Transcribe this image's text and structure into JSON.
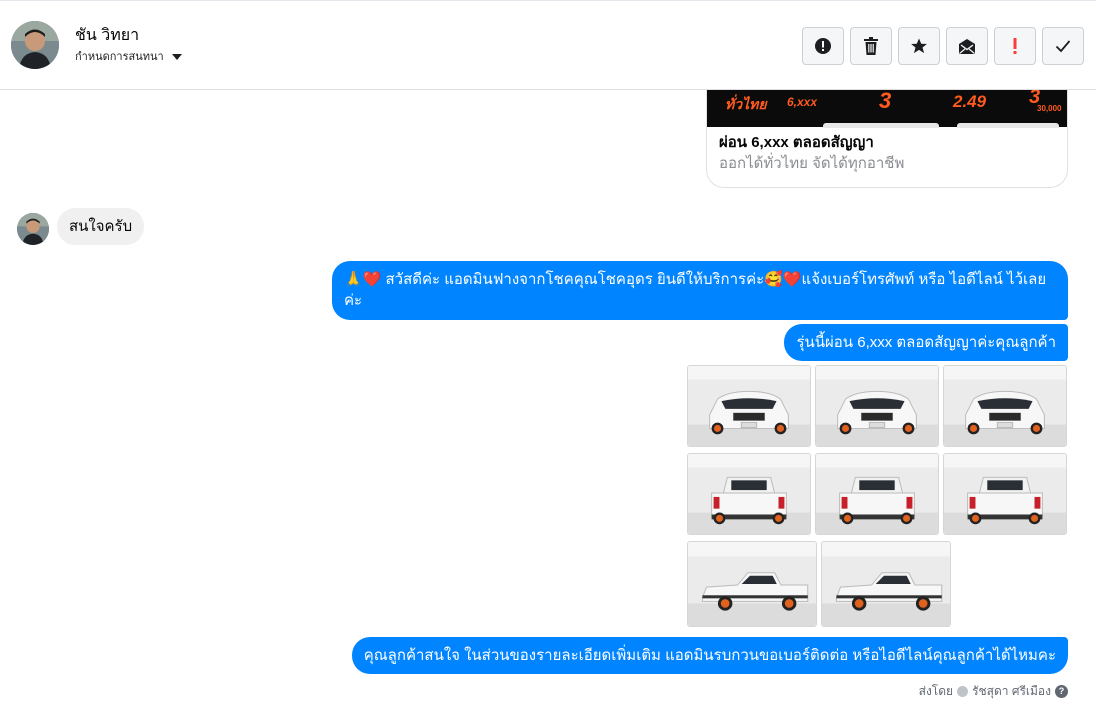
{
  "header": {
    "name": "ชัน วิทยา",
    "assign_label": "กำหนดการสนทนา",
    "actions": [
      {
        "id": "report",
        "icon": "alert-circle-icon"
      },
      {
        "id": "delete",
        "icon": "trash-icon"
      },
      {
        "id": "star",
        "icon": "star-icon"
      },
      {
        "id": "mark-unread",
        "icon": "envelope-icon"
      },
      {
        "id": "important",
        "icon": "exclamation-icon",
        "color": "#fa3e3e"
      },
      {
        "id": "done",
        "icon": "check-icon"
      }
    ]
  },
  "ad": {
    "banner": {
      "t1": "ทั่วไทย",
      "t2": "6,xxx",
      "t3": "3",
      "t4": "2.49",
      "t5": "3",
      "t6": "30,000"
    },
    "title": "ผ่อน 6,xxx ตลอดสัญญา",
    "subtitle": "ออกได้ทั่วไทย จัดได้ทุกอาชีพ"
  },
  "messages": {
    "incoming": "สนใจครับ",
    "out1": "🙏❤️ สวัสดีค่ะ แอดมินฟางจากโชคคุณโชคอุดร ยินดีให้บริการค่ะ🥰❤️แจ้งเบอร์โทรศัพท์ หรือ ไอดีไลน์  ไว้เลยค่ะ",
    "out2": "รุ่นนี้ผ่อน 6,xxx ตลอดสัญญาค่ะคุณลูกค้า",
    "out3": "คุณลูกค้าสนใจ ในส่วนของรายละเอียดเพิ่มเติม แอดมินรบกวนขอเบอร์ติดต่อ หรือไอดีไลน์คุณลูกค้าได้ไหมคะ"
  },
  "photos": [
    {
      "view": "front-left"
    },
    {
      "view": "front"
    },
    {
      "view": "front-right"
    },
    {
      "view": "rear-left"
    },
    {
      "view": "rear"
    },
    {
      "view": "rear-right"
    },
    {
      "view": "side-left"
    },
    {
      "view": "side-right"
    }
  ],
  "sent_by": {
    "prefix": "ส่งโดย",
    "name": "รัชสุดา ศรีเมือง",
    "help": "?"
  },
  "colors": {
    "outgoing_bubble": "#0084ff",
    "incoming_bubble": "#f0f0f0",
    "accent_orange": "#ff5a1f",
    "important_red": "#fa3e3e"
  }
}
